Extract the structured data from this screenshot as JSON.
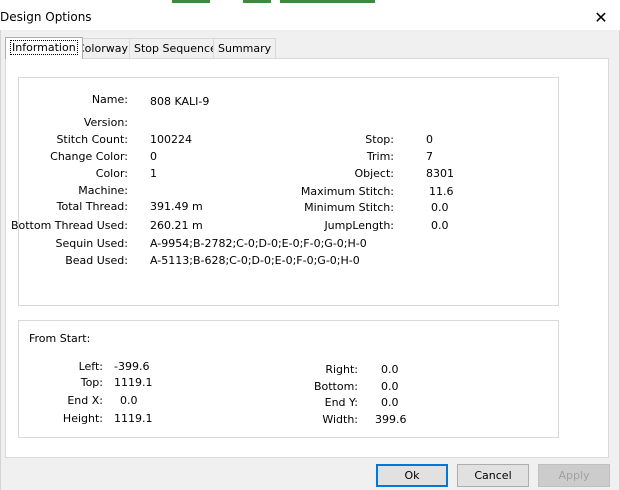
{
  "window": {
    "title": "Design Options"
  },
  "tabs": [
    "Information",
    "Colorway",
    "Stop Sequence",
    "Summary"
  ],
  "info": {
    "name_label": "Name:",
    "name_value": "808 KALI-9",
    "version_label": "Version:",
    "version_value": "",
    "stitch_count_label": "Stitch Count:",
    "stitch_count_value": "100224",
    "change_color_label": "Change Color:",
    "change_color_value": "0",
    "color_label": "Color:",
    "color_value": "1",
    "machine_label": "Machine:",
    "machine_value": "",
    "total_thread_label": "Total Thread:",
    "total_thread_value": "391.49 m",
    "bottom_thread_label": "Bottom Thread Used:",
    "bottom_thread_value": "260.21 m",
    "sequin_label": "Sequin Used:",
    "sequin_value": "A-9954;B-2782;C-0;D-0;E-0;F-0;G-0;H-0",
    "bead_label": "Bead Used:",
    "bead_value": "A-5113;B-628;C-0;D-0;E-0;F-0;G-0;H-0",
    "stop_label": "Stop:",
    "stop_value": "0",
    "trim_label": "Trim:",
    "trim_value": "7",
    "object_label": "Object:",
    "object_value": "8301",
    "max_stitch_label": "Maximum Stitch:",
    "max_stitch_value": "11.6",
    "min_stitch_label": "Minimum Stitch:",
    "min_stitch_value": "0.0",
    "jump_length_label": "JumpLength:",
    "jump_length_value": "0.0"
  },
  "from_start": {
    "heading": "From Start:",
    "left_label": "Left:",
    "left_value": "-399.6",
    "top_label": "Top:",
    "top_value": "1119.1",
    "endx_label": "End X:",
    "endx_value": "0.0",
    "height_label": "Height:",
    "height_value": "1119.1",
    "right_label": "Right:",
    "right_value": "0.0",
    "bottom_label": "Bottom:",
    "bottom_value": "0.0",
    "endy_label": "End Y:",
    "endy_value": "0.0",
    "width_label": "Width:",
    "width_value": "399.6"
  },
  "buttons": {
    "ok": "Ok",
    "cancel": "Cancel",
    "apply": "Apply"
  },
  "colors": {
    "accent": "#0078d7",
    "panel_bg": "#ffffff",
    "dialog_bg": "#f0f0f0"
  }
}
